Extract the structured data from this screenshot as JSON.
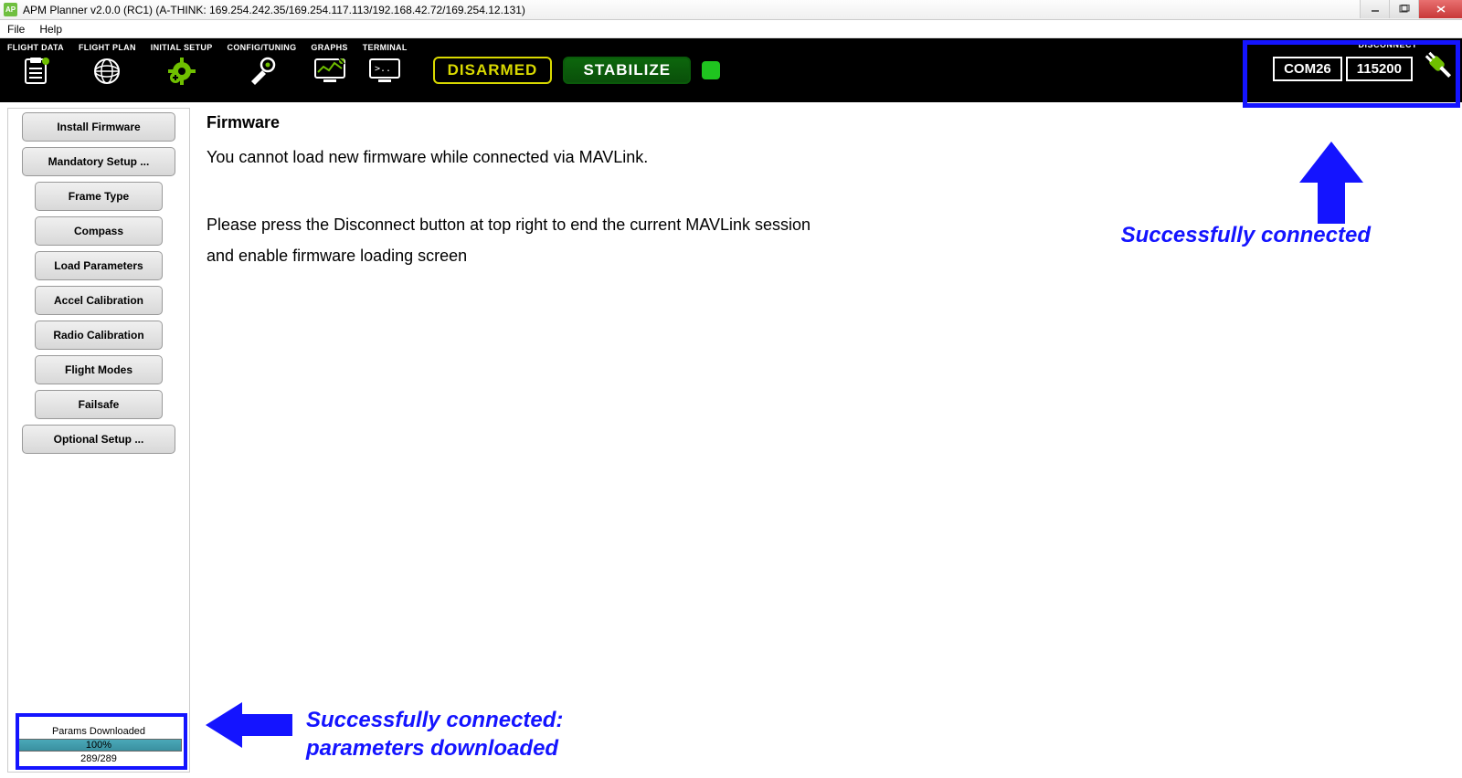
{
  "window": {
    "title": "APM Planner v2.0.0 (RC1) (A-THINK: 169.254.242.35/169.254.117.113/192.168.42.72/169.254.12.131)"
  },
  "menu": {
    "file": "File",
    "help": "Help"
  },
  "toolbar": {
    "flight_data": "FLIGHT DATA",
    "flight_plan": "FLIGHT PLAN",
    "initial_setup": "INITIAL SETUP",
    "config_tuning": "CONFIG/TUNING",
    "graphs": "GRAPHS",
    "terminal": "TERMINAL"
  },
  "status": {
    "armed": "DISARMED",
    "mode": "STABILIZE"
  },
  "connection": {
    "label": "DISCONNECT",
    "port": "COM26",
    "baud": "115200"
  },
  "sidebar": {
    "install_firmware": "Install Firmware",
    "mandatory_setup": "Mandatory Setup ...",
    "frame_type": "Frame Type",
    "compass": "Compass",
    "load_parameters": "Load Parameters",
    "accel_calibration": "Accel Calibration",
    "radio_calibration": "Radio Calibration",
    "flight_modes": "Flight Modes",
    "failsafe": "Failsafe",
    "optional_setup": "Optional Setup ..."
  },
  "params": {
    "title": "Params Downloaded",
    "percent": "100%",
    "count": "289/289",
    "fill_width": "100%"
  },
  "content": {
    "heading": "Firmware",
    "line1": "You cannot load new firmware while connected via MAVLink.",
    "line2": "Please press the Disconnect button at top right to end the current MAVLink session and enable firmware loading screen"
  },
  "annotations": {
    "connected": "Successfully connected",
    "params_line1": "Successfully connected:",
    "params_line2": "parameters downloaded"
  }
}
